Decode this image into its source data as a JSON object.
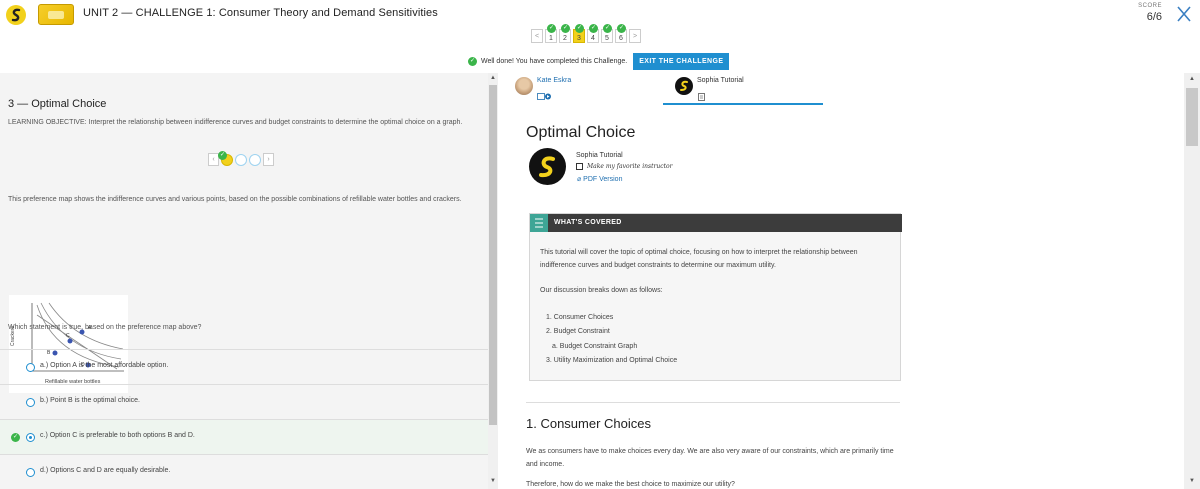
{
  "header": {
    "course_title": "UNIT 2 — CHALLENGE 1: Consumer Theory and Demand Sensitivities",
    "score_label": "SCORE",
    "score_value": "6/6"
  },
  "pager": {
    "prev": "<",
    "next": ">",
    "pages": [
      {
        "label": "1",
        "done": true,
        "current": false
      },
      {
        "label": "2",
        "done": true,
        "current": false
      },
      {
        "label": "3",
        "done": true,
        "current": true
      },
      {
        "label": "4",
        "done": true,
        "current": false
      },
      {
        "label": "5",
        "done": true,
        "current": false
      },
      {
        "label": "6",
        "done": true,
        "current": false
      }
    ]
  },
  "status": {
    "message": "Well done! You have completed this Challenge.",
    "exit_button": "EXIT THE CHALLENGE"
  },
  "question": {
    "heading": "3 — Optimal Choice",
    "objective": "LEARNING OBJECTIVE: Interpret the relationship between indifference curves and budget constraints to determine the optimal choice on a graph.",
    "intro": "This preference map shows the indifference curves and various points, based on the possible combinations of refillable water bottles and crackers.",
    "graph": {
      "y_label": "Crackers",
      "x_label": "Refillable water bottles",
      "points": [
        "A",
        "B",
        "C",
        "D"
      ]
    },
    "prompt": "Which statement is true, based on the preference map above?",
    "options": [
      {
        "text": "a.) Option A is the most affordable option.",
        "selected": false,
        "correct": false
      },
      {
        "text": "b.) Point B is the optimal choice.",
        "selected": false,
        "correct": false
      },
      {
        "text": "c.) Option C is preferable to both options B and D.",
        "selected": true,
        "correct": true
      },
      {
        "text": "d.) Options C and D are equally desirable.",
        "selected": false,
        "correct": false
      }
    ]
  },
  "tutorial": {
    "tab_left": "Kate Eskra",
    "tab_right": "Sophia Tutorial",
    "title": "Optimal Choice",
    "author": "Sophia Tutorial",
    "favorite_label": "Make my favorite instructor",
    "pdf_label": "PDF Version",
    "covered_label": "WHAT'S COVERED",
    "covered_intro": "This tutorial will cover the topic of optimal choice, focusing on how to interpret the relationship between indifference curves and budget constraints to determine our maximum utility.",
    "covered_breakdown": "Our discussion breaks down as follows:",
    "covered_items": [
      "1. Consumer Choices",
      "2. Budget Constraint",
      "a. Budget Constraint Graph",
      "3. Utility Maximization and Optimal Choice"
    ],
    "section_title": "1. Consumer Choices",
    "section_para": "We as consumers have to make choices every day. We are also very aware of our constraints, which are primarily time and income.",
    "section_para2": "Therefore, how do we make the best choice to maximize our utility?"
  },
  "colors": {
    "brand_yellow": "#f2d11c",
    "accent_blue": "#1f8fd0",
    "success_green": "#3bb54a",
    "covered_teal": "#3ea596"
  }
}
